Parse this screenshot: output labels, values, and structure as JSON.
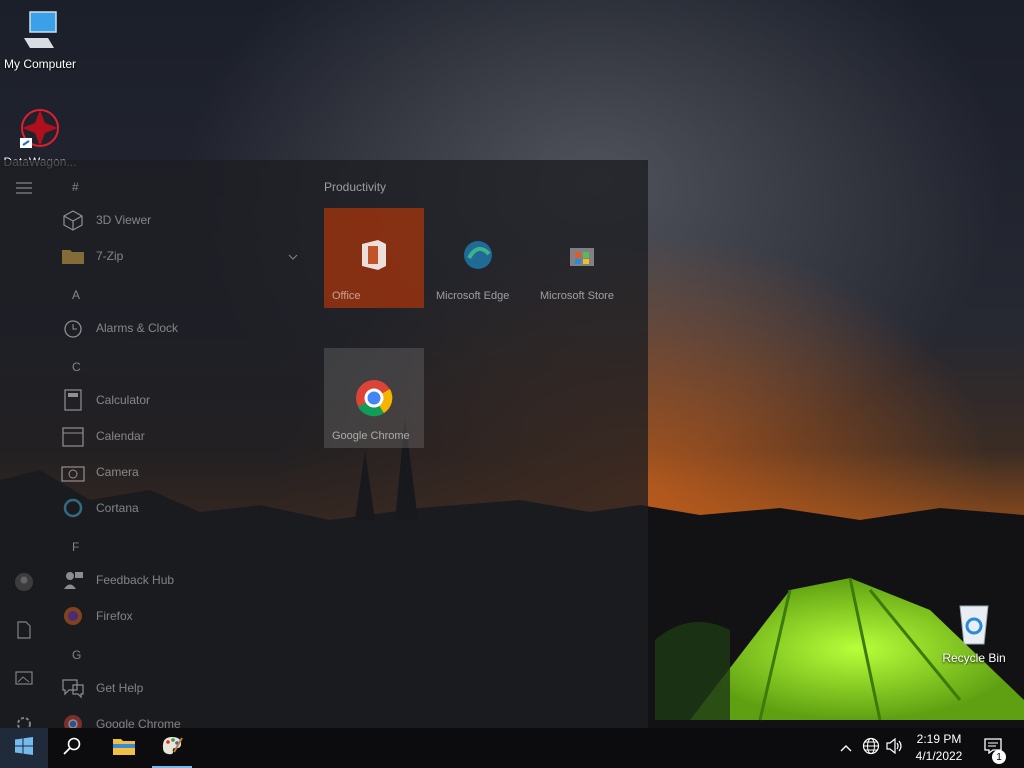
{
  "desktop": {
    "icons": [
      {
        "label": "My Computer"
      },
      {
        "label": "DataWagon..."
      },
      {
        "label": "Recycle Bin"
      }
    ]
  },
  "start_menu": {
    "groups": [
      {
        "letter": "#"
      },
      {
        "letter": "A"
      },
      {
        "letter": "C"
      },
      {
        "letter": "F"
      },
      {
        "letter": "G"
      }
    ],
    "apps": [
      {
        "label": "3D Viewer",
        "icon": "cube-icon"
      },
      {
        "label": "7-Zip",
        "icon": "folder-icon"
      },
      {
        "label": "Alarms & Clock",
        "icon": "clock-icon"
      },
      {
        "label": "Calculator",
        "icon": "calculator-icon"
      },
      {
        "label": "Calendar",
        "icon": "calendar-icon"
      },
      {
        "label": "Camera",
        "icon": "camera-icon"
      },
      {
        "label": "Cortana",
        "icon": "cortana-icon"
      },
      {
        "label": "Feedback Hub",
        "icon": "feedback-icon"
      },
      {
        "label": "Firefox",
        "icon": "firefox-icon"
      },
      {
        "label": "Get Help",
        "icon": "help-icon"
      },
      {
        "label": "Google Chrome",
        "icon": "chrome-icon"
      }
    ],
    "tile_group_title": "Productivity",
    "tiles": [
      {
        "label": "Office",
        "color": "#d83b01"
      },
      {
        "label": "Microsoft Edge"
      },
      {
        "label": "Microsoft Store"
      },
      {
        "label": "Google Chrome"
      }
    ]
  },
  "taskbar": {
    "clock_time": "2:19 PM",
    "clock_date": "4/1/2022",
    "notification_count": "1",
    "accent": "#76b9ed"
  }
}
